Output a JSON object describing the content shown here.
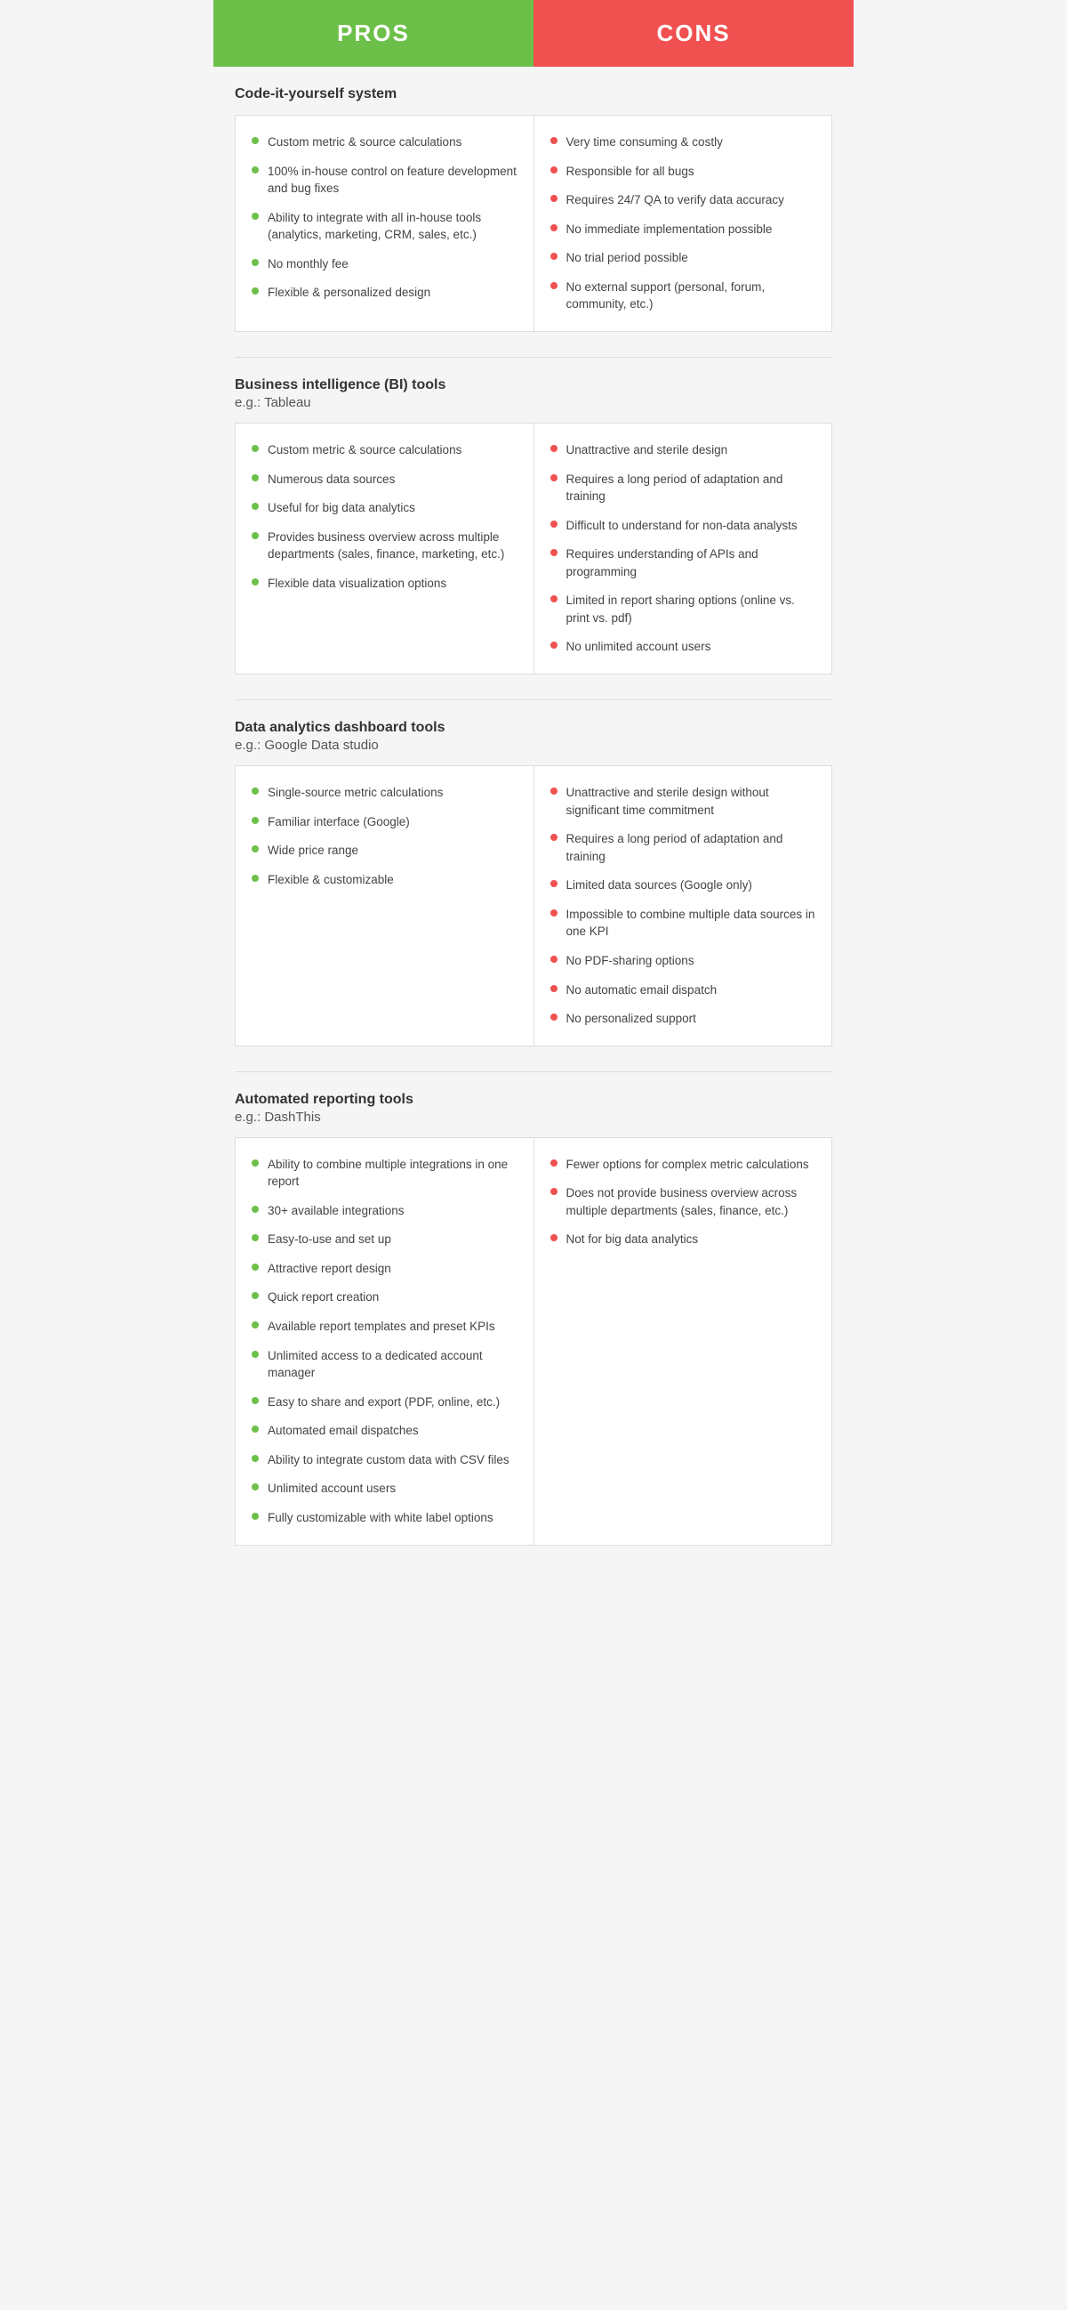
{
  "header": {
    "pros_label": "PROS",
    "cons_label": "CONS"
  },
  "sections": [
    {
      "id": "code-it-yourself",
      "title": "Code-it-yourself system",
      "subtitle": null,
      "pros": [
        "Custom metric & source calculations",
        "100% in-house control on feature development and bug fixes",
        "Ability to integrate with all in-house tools (analytics, marketing, CRM, sales, etc.)",
        "No monthly fee",
        "Flexible & personalized design"
      ],
      "cons": [
        "Very time consuming & costly",
        "Responsible for all bugs",
        "Requires 24/7 QA to verify data accuracy",
        "No immediate implementation possible",
        "No trial period possible",
        "No external support (personal, forum, community, etc.)"
      ]
    },
    {
      "id": "bi-tools",
      "title": "Business intelligence (BI) tools",
      "subtitle": "e.g.: Tableau",
      "pros": [
        "Custom metric & source calculations",
        "Numerous data sources",
        "Useful for big data analytics",
        "Provides business overview across multiple departments (sales, finance, marketing, etc.)",
        "Flexible data visualization options"
      ],
      "cons": [
        "Unattractive and sterile design",
        "Requires a long period of adaptation and training",
        "Difficult to understand for non-data analysts",
        "Requires understanding of APIs and programming",
        "Limited in report sharing options (online vs. print vs. pdf)",
        "No unlimited account users"
      ]
    },
    {
      "id": "data-analytics-dashboard",
      "title": "Data analytics dashboard tools",
      "subtitle": "e.g.: Google Data studio",
      "pros": [
        "Single-source metric calculations",
        "Familiar interface (Google)",
        "Wide price range",
        "Flexible & customizable"
      ],
      "cons": [
        "Unattractive and sterile design without significant time commitment",
        "Requires a long period of adaptation and training",
        "Limited data sources (Google only)",
        "Impossible to combine multiple data sources in one KPI",
        "No PDF-sharing options",
        "No automatic email dispatch",
        "No personalized support"
      ]
    },
    {
      "id": "automated-reporting",
      "title": "Automated reporting tools",
      "subtitle": "e.g.: DashThis",
      "pros": [
        "Ability to combine multiple integrations in one report",
        "30+ available integrations",
        "Easy-to-use and set up",
        "Attractive report design",
        "Quick report creation",
        "Available report templates and preset KPIs",
        "Unlimited access to a dedicated account manager",
        "Easy to share and export (PDF, online, etc.)",
        "Automated email dispatches",
        "Ability to integrate custom data with CSV files",
        "Unlimited account users",
        "Fully customizable with white label options"
      ],
      "cons": [
        "Fewer options for complex metric calculations",
        "Does not provide business overview across multiple departments (sales, finance, etc.)",
        "Not for big data analytics"
      ]
    }
  ]
}
